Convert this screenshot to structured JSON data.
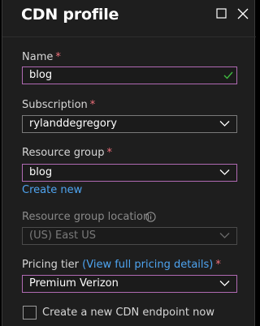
{
  "panel": {
    "title": "CDN profile"
  },
  "fields": {
    "name": {
      "label": "Name",
      "required_mark": "*",
      "value": "blog"
    },
    "subscription": {
      "label": "Subscription",
      "required_mark": "*",
      "value": "rylanddegregory"
    },
    "resource_group": {
      "label": "Resource group",
      "required_mark": "*",
      "value": "blog",
      "create_new_link": "Create new"
    },
    "resource_group_location": {
      "label": "Resource group location",
      "value": "(US) East US"
    },
    "pricing_tier": {
      "label": "Pricing tier",
      "link_open": "(",
      "link_text": "View full pricing details",
      "link_close": ")",
      "required_mark": "*",
      "value": "Premium Verizon"
    }
  },
  "endpoint_option": {
    "label": "Create a new CDN endpoint now",
    "checked": false
  },
  "colors": {
    "accent_focus": "#b06ab3",
    "link": "#4ea4f0",
    "required": "#f1707b",
    "valid_check": "#3fb93f"
  },
  "icons": [
    "maximize-icon",
    "close-icon",
    "checkmark-icon",
    "chevron-down-icon",
    "info-icon"
  ]
}
